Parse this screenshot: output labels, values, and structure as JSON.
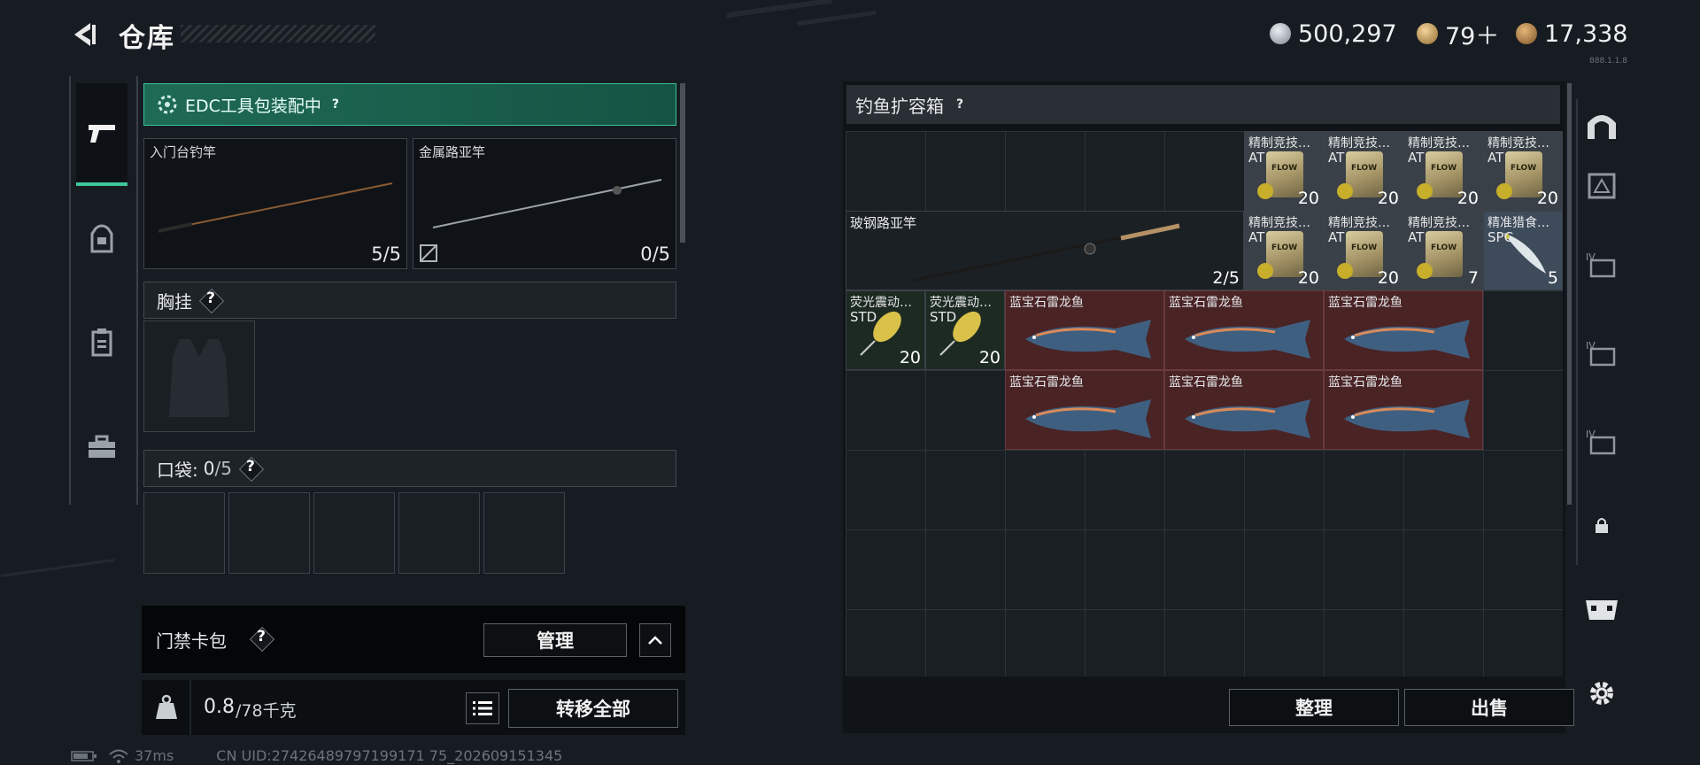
{
  "header": {
    "title": "仓库"
  },
  "currencies": [
    {
      "icon": "silver-coin-icon",
      "value": "500,297",
      "color": "#9aa2aa"
    },
    {
      "icon": "gold-triangle-coin-icon",
      "value": "79＋",
      "color": "#c9a25a"
    },
    {
      "icon": "bronze-coin-icon",
      "value": "17,338",
      "color": "#b98a4a"
    }
  ],
  "version_text": "888.1.1.8",
  "equipment": {
    "edc_label": "EDC工具包装配中",
    "help": "?",
    "rods": [
      {
        "label": "入门台钓竿",
        "count": "5/5"
      },
      {
        "label": "金属路亚竿",
        "count": "0/5"
      }
    ],
    "chest_label": "胸挂",
    "pocket_label": "口袋:",
    "pocket_count": "0",
    "pocket_total": "/5",
    "keycard_label": "门禁卡包",
    "manage_label": "管理",
    "weight_current": "0.8",
    "weight_max": "/78千克",
    "transfer_label": "转移全部"
  },
  "storage": {
    "title": "钓鱼扩容箱",
    "bait_name": "精制竞技…",
    "bait_sub": "AT",
    "bait_brand": "FLOW",
    "bait_counts": [
      "20",
      "20",
      "20",
      "20",
      "20",
      "20",
      "7"
    ],
    "special_bait": {
      "name": "精准猎食…",
      "sub": "SPC",
      "count": "5"
    },
    "rod": {
      "name": "玻钢路亚竿",
      "count": "2/5"
    },
    "lures": [
      {
        "name": "荧光震动…",
        "sub": "STD",
        "count": "20"
      },
      {
        "name": "荧光震动…",
        "sub": "STD",
        "count": "20"
      }
    ],
    "fish_name": "蓝宝石雷龙鱼",
    "sort_label": "整理",
    "sell_label": "出售"
  },
  "status_bar": {
    "ping": "37ms",
    "uid": "CN UID:27426489797199171 75_202609151345"
  }
}
